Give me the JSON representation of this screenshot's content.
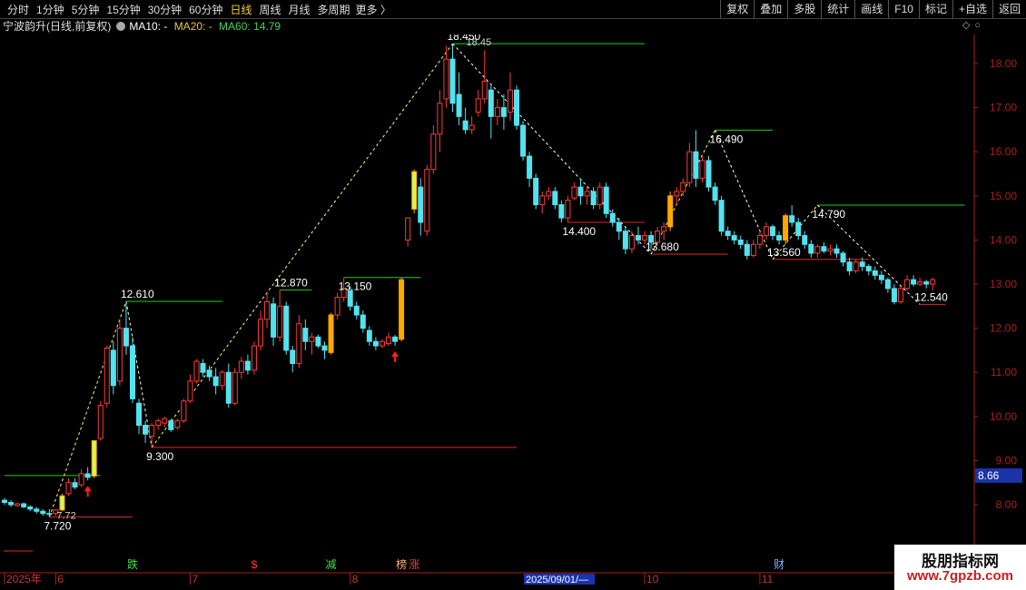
{
  "toolbar": {
    "periods": [
      "分时",
      "1分钟",
      "5分钟",
      "15分钟",
      "30分钟",
      "60分钟",
      "日线",
      "周线",
      "月线",
      "多周期"
    ],
    "active_period": "日线",
    "more": "更多",
    "right_tools": [
      "复权",
      "叠加",
      "多股",
      "统计",
      "画线",
      "F10",
      "标记",
      "+自选",
      "返回"
    ]
  },
  "info": {
    "stock_name": "宁波韵升(日线,前复权)",
    "ma10": "MA10: -",
    "ma20": "MA20: -",
    "ma60": "MA60: 14.79"
  },
  "colors": {
    "up": "#ff3a3a",
    "down": "#52e3f0",
    "signal": "#ffa800",
    "signal_light": "#d6f55a",
    "resistance_line": "#19d219",
    "support_line": "#e0282c",
    "zigzag": "#ffff66",
    "zigzag_down": "#ffffff",
    "axis": "#b01c1c",
    "current_price_bg": "#1b33a8"
  },
  "watermark": {
    "line1": "股朋指标网",
    "line2": "www.7gpzb.com"
  },
  "chart_data": {
    "type": "candlestick",
    "title": "宁波韵升",
    "y_ticks": [
      8.0,
      9.0,
      10.0,
      11.0,
      12.0,
      13.0,
      14.0,
      15.0,
      16.0,
      17.0,
      18.0
    ],
    "current_price": "8.66",
    "ylim": [
      7.2,
      18.8
    ],
    "x_labels": [
      "2025年",
      "6",
      "7",
      "8",
      "10",
      "11"
    ],
    "date_cursor": "2025/09/01/—",
    "candles": [
      {
        "o": 8.1,
        "h": 8.15,
        "l": 8.0,
        "c": 8.05
      },
      {
        "o": 8.05,
        "h": 8.1,
        "l": 7.95,
        "c": 8.0
      },
      {
        "o": 7.98,
        "h": 8.05,
        "l": 7.95,
        "c": 8.02
      },
      {
        "o": 8.02,
        "h": 8.05,
        "l": 7.92,
        "c": 7.95
      },
      {
        "o": 7.95,
        "h": 7.98,
        "l": 7.85,
        "c": 7.9
      },
      {
        "o": 7.9,
        "h": 7.95,
        "l": 7.8,
        "c": 7.85
      },
      {
        "o": 7.85,
        "h": 7.9,
        "l": 7.75,
        "c": 7.8
      },
      {
        "o": 7.8,
        "h": 7.9,
        "l": 7.72,
        "c": 7.78
      },
      {
        "o": 7.8,
        "h": 7.9,
        "l": 7.75,
        "c": 7.88
      },
      {
        "o": 7.88,
        "h": 8.25,
        "l": 7.85,
        "c": 8.2,
        "sig": "hl"
      },
      {
        "o": 8.25,
        "h": 8.6,
        "l": 8.2,
        "c": 8.5
      },
      {
        "o": 8.5,
        "h": 8.6,
        "l": 8.35,
        "c": 8.4
      },
      {
        "o": 8.45,
        "h": 8.8,
        "l": 8.4,
        "c": 8.7
      },
      {
        "o": 8.7,
        "h": 8.85,
        "l": 8.55,
        "c": 8.62
      },
      {
        "o": 8.65,
        "h": 9.45,
        "l": 8.6,
        "c": 9.45,
        "sig": "hl"
      },
      {
        "o": 9.5,
        "h": 10.35,
        "l": 9.45,
        "c": 10.25
      },
      {
        "o": 10.3,
        "h": 11.6,
        "l": 10.2,
        "c": 11.55
      },
      {
        "o": 11.5,
        "h": 11.7,
        "l": 10.5,
        "c": 10.7
      },
      {
        "o": 10.8,
        "h": 12.2,
        "l": 10.7,
        "c": 12.0
      },
      {
        "o": 12.0,
        "h": 12.61,
        "l": 11.4,
        "c": 11.6
      },
      {
        "o": 11.6,
        "h": 11.8,
        "l": 10.3,
        "c": 10.4
      },
      {
        "o": 10.3,
        "h": 10.4,
        "l": 9.6,
        "c": 9.8
      },
      {
        "o": 9.8,
        "h": 9.9,
        "l": 9.4,
        "c": 9.6
      },
      {
        "o": 9.55,
        "h": 9.85,
        "l": 9.3,
        "c": 9.8
      },
      {
        "o": 9.8,
        "h": 9.95,
        "l": 9.7,
        "c": 9.9
      },
      {
        "o": 9.85,
        "h": 10.0,
        "l": 9.75,
        "c": 9.95
      },
      {
        "o": 9.9,
        "h": 9.95,
        "l": 9.65,
        "c": 9.7
      },
      {
        "o": 9.75,
        "h": 9.95,
        "l": 9.7,
        "c": 9.9
      },
      {
        "o": 9.9,
        "h": 10.4,
        "l": 9.85,
        "c": 10.35
      },
      {
        "o": 10.35,
        "h": 10.95,
        "l": 10.3,
        "c": 10.8
      },
      {
        "o": 10.8,
        "h": 11.3,
        "l": 10.75,
        "c": 11.25
      },
      {
        "o": 11.2,
        "h": 11.3,
        "l": 10.9,
        "c": 11.0
      },
      {
        "o": 11.05,
        "h": 11.15,
        "l": 10.8,
        "c": 10.9
      },
      {
        "o": 10.9,
        "h": 11.1,
        "l": 10.5,
        "c": 10.7
      },
      {
        "o": 10.7,
        "h": 11.05,
        "l": 10.6,
        "c": 11.0
      },
      {
        "o": 11.0,
        "h": 11.2,
        "l": 10.2,
        "c": 10.3
      },
      {
        "o": 10.3,
        "h": 11.1,
        "l": 10.25,
        "c": 11.0
      },
      {
        "o": 11.0,
        "h": 11.35,
        "l": 10.85,
        "c": 11.25
      },
      {
        "o": 11.25,
        "h": 11.4,
        "l": 10.95,
        "c": 11.05
      },
      {
        "o": 11.05,
        "h": 11.7,
        "l": 10.95,
        "c": 11.6
      },
      {
        "o": 11.6,
        "h": 12.4,
        "l": 11.5,
        "c": 12.2
      },
      {
        "o": 12.2,
        "h": 12.8,
        "l": 12.0,
        "c": 12.6
      },
      {
        "o": 12.55,
        "h": 12.7,
        "l": 11.6,
        "c": 11.8
      },
      {
        "o": 11.8,
        "h": 12.87,
        "l": 11.7,
        "c": 12.5
      },
      {
        "o": 12.5,
        "h": 12.6,
        "l": 11.4,
        "c": 11.5
      },
      {
        "o": 11.5,
        "h": 11.6,
        "l": 11.0,
        "c": 11.2
      },
      {
        "o": 11.2,
        "h": 12.3,
        "l": 11.1,
        "c": 12.1
      },
      {
        "o": 12.0,
        "h": 12.2,
        "l": 11.5,
        "c": 11.7
      },
      {
        "o": 11.7,
        "h": 11.9,
        "l": 11.4,
        "c": 11.8
      },
      {
        "o": 11.8,
        "h": 11.85,
        "l": 11.55,
        "c": 11.6
      },
      {
        "o": 11.6,
        "h": 11.7,
        "l": 11.3,
        "c": 11.5
      },
      {
        "o": 11.45,
        "h": 12.35,
        "l": 11.4,
        "c": 12.3,
        "sig": "sig"
      },
      {
        "o": 12.3,
        "h": 12.8,
        "l": 12.2,
        "c": 12.7
      },
      {
        "o": 12.7,
        "h": 13.15,
        "l": 12.6,
        "c": 12.9
      },
      {
        "o": 12.85,
        "h": 12.95,
        "l": 12.4,
        "c": 12.5
      },
      {
        "o": 12.5,
        "h": 12.6,
        "l": 12.2,
        "c": 12.3
      },
      {
        "o": 12.3,
        "h": 12.4,
        "l": 11.9,
        "c": 12.0
      },
      {
        "o": 11.95,
        "h": 12.05,
        "l": 11.6,
        "c": 11.7
      },
      {
        "o": 11.7,
        "h": 11.8,
        "l": 11.5,
        "c": 11.6
      },
      {
        "o": 11.6,
        "h": 11.75,
        "l": 11.55,
        "c": 11.7
      },
      {
        "o": 11.65,
        "h": 11.9,
        "l": 11.6,
        "c": 11.8
      },
      {
        "o": 11.8,
        "h": 11.85,
        "l": 11.6,
        "c": 11.7
      },
      {
        "o": 11.75,
        "h": 13.15,
        "l": 11.7,
        "c": 13.1,
        "sig": "sig"
      },
      {
        "o": 14.0,
        "h": 14.5,
        "l": 13.85,
        "c": 14.5
      },
      {
        "o": 14.7,
        "h": 15.6,
        "l": 14.6,
        "c": 15.55,
        "sig": "hl"
      },
      {
        "o": 15.2,
        "h": 15.4,
        "l": 14.1,
        "c": 14.4
      },
      {
        "o": 14.2,
        "h": 15.7,
        "l": 14.1,
        "c": 15.6
      },
      {
        "o": 15.6,
        "h": 16.6,
        "l": 15.5,
        "c": 16.4
      },
      {
        "o": 16.4,
        "h": 17.4,
        "l": 16.0,
        "c": 17.1
      },
      {
        "o": 17.2,
        "h": 18.4,
        "l": 17.0,
        "c": 18.1
      },
      {
        "o": 18.1,
        "h": 18.45,
        "l": 16.9,
        "c": 17.1
      },
      {
        "o": 17.3,
        "h": 17.8,
        "l": 16.6,
        "c": 16.8
      },
      {
        "o": 16.7,
        "h": 17.0,
        "l": 16.4,
        "c": 16.5
      },
      {
        "o": 16.5,
        "h": 16.8,
        "l": 16.4,
        "c": 16.6
      },
      {
        "o": 16.9,
        "h": 17.4,
        "l": 16.8,
        "c": 17.2
      },
      {
        "o": 17.2,
        "h": 18.3,
        "l": 17.1,
        "c": 17.6
      },
      {
        "o": 17.4,
        "h": 17.5,
        "l": 16.3,
        "c": 16.8
      },
      {
        "o": 16.8,
        "h": 17.2,
        "l": 16.6,
        "c": 17.0
      },
      {
        "o": 17.0,
        "h": 17.3,
        "l": 16.5,
        "c": 16.8
      },
      {
        "o": 16.9,
        "h": 17.8,
        "l": 16.7,
        "c": 17.4
      },
      {
        "o": 17.4,
        "h": 17.5,
        "l": 16.5,
        "c": 16.6
      },
      {
        "o": 16.6,
        "h": 16.7,
        "l": 15.8,
        "c": 15.9
      },
      {
        "o": 15.9,
        "h": 16.0,
        "l": 15.2,
        "c": 15.4
      },
      {
        "o": 15.4,
        "h": 15.5,
        "l": 14.7,
        "c": 14.8
      },
      {
        "o": 14.8,
        "h": 15.1,
        "l": 14.6,
        "c": 15.0
      },
      {
        "o": 15.0,
        "h": 15.2,
        "l": 14.9,
        "c": 15.1
      },
      {
        "o": 15.1,
        "h": 15.2,
        "l": 14.7,
        "c": 14.8
      },
      {
        "o": 14.8,
        "h": 14.9,
        "l": 14.4,
        "c": 14.5
      },
      {
        "o": 14.5,
        "h": 15.0,
        "l": 14.4,
        "c": 14.9
      },
      {
        "o": 14.95,
        "h": 15.3,
        "l": 14.9,
        "c": 15.2
      },
      {
        "o": 15.2,
        "h": 15.4,
        "l": 14.8,
        "c": 15.0
      },
      {
        "o": 15.0,
        "h": 15.2,
        "l": 14.8,
        "c": 15.1
      },
      {
        "o": 15.1,
        "h": 15.2,
        "l": 14.7,
        "c": 14.8
      },
      {
        "o": 14.8,
        "h": 15.3,
        "l": 14.7,
        "c": 15.2
      },
      {
        "o": 15.2,
        "h": 15.3,
        "l": 14.5,
        "c": 14.6
      },
      {
        "o": 14.6,
        "h": 14.7,
        "l": 14.3,
        "c": 14.4
      },
      {
        "o": 14.4,
        "h": 14.5,
        "l": 14.0,
        "c": 14.2
      },
      {
        "o": 14.2,
        "h": 14.3,
        "l": 13.68,
        "c": 13.8
      },
      {
        "o": 13.8,
        "h": 14.2,
        "l": 13.7,
        "c": 14.1
      },
      {
        "o": 14.1,
        "h": 14.3,
        "l": 13.9,
        "c": 14.0
      },
      {
        "o": 14.0,
        "h": 14.2,
        "l": 13.9,
        "c": 14.1
      },
      {
        "o": 14.1,
        "h": 14.2,
        "l": 13.8,
        "c": 13.95
      },
      {
        "o": 13.95,
        "h": 14.3,
        "l": 13.9,
        "c": 14.2
      },
      {
        "o": 14.2,
        "h": 14.4,
        "l": 14.0,
        "c": 14.3
      },
      {
        "o": 14.3,
        "h": 15.1,
        "l": 14.2,
        "c": 15.0,
        "sig": "sig"
      },
      {
        "o": 15.0,
        "h": 15.2,
        "l": 14.8,
        "c": 15.1
      },
      {
        "o": 15.1,
        "h": 15.4,
        "l": 15.0,
        "c": 15.3
      },
      {
        "o": 15.3,
        "h": 16.2,
        "l": 15.2,
        "c": 16.0
      },
      {
        "o": 16.0,
        "h": 16.49,
        "l": 15.2,
        "c": 15.4
      },
      {
        "o": 15.4,
        "h": 15.9,
        "l": 15.3,
        "c": 15.8
      },
      {
        "o": 15.8,
        "h": 15.9,
        "l": 15.1,
        "c": 15.2
      },
      {
        "o": 15.2,
        "h": 15.3,
        "l": 14.8,
        "c": 14.9
      },
      {
        "o": 14.9,
        "h": 15.0,
        "l": 14.1,
        "c": 14.2
      },
      {
        "o": 14.2,
        "h": 14.3,
        "l": 14.0,
        "c": 14.1
      },
      {
        "o": 14.1,
        "h": 14.2,
        "l": 13.9,
        "c": 14.0
      },
      {
        "o": 14.0,
        "h": 14.1,
        "l": 13.8,
        "c": 13.9
      },
      {
        "o": 13.9,
        "h": 14.0,
        "l": 13.56,
        "c": 13.65
      },
      {
        "o": 13.65,
        "h": 14.0,
        "l": 13.6,
        "c": 13.9
      },
      {
        "o": 13.9,
        "h": 14.2,
        "l": 13.8,
        "c": 14.1
      },
      {
        "o": 14.1,
        "h": 14.4,
        "l": 14.0,
        "c": 14.3
      },
      {
        "o": 14.3,
        "h": 14.35,
        "l": 14.0,
        "c": 14.1
      },
      {
        "o": 14.1,
        "h": 14.2,
        "l": 13.9,
        "c": 14.0
      },
      {
        "o": 14.0,
        "h": 14.6,
        "l": 13.9,
        "c": 14.55,
        "sig": "sig"
      },
      {
        "o": 14.55,
        "h": 14.79,
        "l": 14.3,
        "c": 14.4
      },
      {
        "o": 14.4,
        "h": 14.5,
        "l": 14.0,
        "c": 14.1
      },
      {
        "o": 14.1,
        "h": 14.2,
        "l": 13.8,
        "c": 13.9
      },
      {
        "o": 13.9,
        "h": 14.0,
        "l": 13.6,
        "c": 13.7
      },
      {
        "o": 13.7,
        "h": 13.9,
        "l": 13.6,
        "c": 13.85
      },
      {
        "o": 13.85,
        "h": 13.95,
        "l": 13.7,
        "c": 13.75
      },
      {
        "o": 13.75,
        "h": 13.9,
        "l": 13.65,
        "c": 13.8
      },
      {
        "o": 13.8,
        "h": 13.9,
        "l": 13.6,
        "c": 13.7
      },
      {
        "o": 13.7,
        "h": 13.75,
        "l": 13.4,
        "c": 13.5
      },
      {
        "o": 13.5,
        "h": 13.6,
        "l": 13.2,
        "c": 13.3
      },
      {
        "o": 13.3,
        "h": 13.55,
        "l": 13.25,
        "c": 13.5
      },
      {
        "o": 13.5,
        "h": 13.6,
        "l": 13.3,
        "c": 13.4
      },
      {
        "o": 13.4,
        "h": 13.45,
        "l": 13.2,
        "c": 13.3
      },
      {
        "o": 13.3,
        "h": 13.4,
        "l": 13.1,
        "c": 13.2
      },
      {
        "o": 13.2,
        "h": 13.3,
        "l": 13.0,
        "c": 13.1
      },
      {
        "o": 13.1,
        "h": 13.15,
        "l": 12.8,
        "c": 12.9
      },
      {
        "o": 12.9,
        "h": 13.0,
        "l": 12.54,
        "c": 12.6
      },
      {
        "o": 12.6,
        "h": 12.95,
        "l": 12.55,
        "c": 12.9
      },
      {
        "o": 12.9,
        "h": 13.2,
        "l": 12.85,
        "c": 13.1
      },
      {
        "o": 13.1,
        "h": 13.2,
        "l": 12.95,
        "c": 13.0
      },
      {
        "o": 13.0,
        "h": 13.15,
        "l": 12.95,
        "c": 13.05
      },
      {
        "o": 13.05,
        "h": 13.1,
        "l": 12.9,
        "c": 13.0
      },
      {
        "o": 13.0,
        "h": 13.15,
        "l": 12.85,
        "c": 13.1
      }
    ],
    "pivots": [
      {
        "i": 7,
        "p": 7.72,
        "label": "7.720"
      },
      {
        "i": 19,
        "p": 12.61,
        "label": "12.610"
      },
      {
        "i": 23,
        "p": 9.3,
        "label": "9.300"
      },
      {
        "i": 43,
        "p": 12.87,
        "label": "12.870"
      },
      {
        "i": 53,
        "p": 13.15,
        "label": "13.150"
      },
      {
        "i": 70,
        "p": 18.45,
        "label": "18.450"
      },
      {
        "i": 88,
        "p": 14.4,
        "label": "14.400"
      },
      {
        "i": 101,
        "p": 13.68,
        "label": "13.680"
      },
      {
        "i": 111,
        "p": 16.49,
        "label": "16.490"
      },
      {
        "i": 120,
        "p": 13.56,
        "label": "13.560"
      },
      {
        "i": 127,
        "p": 14.79,
        "label": "14.790"
      },
      {
        "i": 143,
        "p": 12.54,
        "label": "12.540"
      }
    ],
    "zigzag_path": [
      7,
      19,
      23,
      70,
      101,
      111,
      120,
      127,
      143
    ],
    "annotations": [
      {
        "i": 7,
        "p": 7.72,
        "text": "7.72"
      },
      {
        "i": 71,
        "p": 18.45,
        "text": "18.45"
      }
    ],
    "levels": [
      {
        "from": 0,
        "to": 15,
        "p": 8.66,
        "kind": "resistance"
      },
      {
        "from": 19,
        "to": 34,
        "p": 12.61,
        "kind": "resistance"
      },
      {
        "from": 43,
        "to": 48,
        "p": 12.87,
        "kind": "resistance"
      },
      {
        "from": 53,
        "to": 65,
        "p": 13.15,
        "kind": "resistance"
      },
      {
        "from": 70,
        "to": 100,
        "p": 18.45,
        "kind": "resistance"
      },
      {
        "from": 111,
        "to": 120,
        "p": 16.49,
        "kind": "resistance"
      },
      {
        "from": 127,
        "to": 150,
        "p": 14.79,
        "kind": "resistance"
      },
      {
        "from": 7,
        "to": 20,
        "p": 7.72,
        "kind": "support"
      },
      {
        "from": 23,
        "to": 80,
        "p": 9.3,
        "kind": "support"
      },
      {
        "from": 88,
        "to": 100,
        "p": 14.4,
        "kind": "support"
      },
      {
        "from": 101,
        "to": 113,
        "p": 13.68,
        "kind": "support"
      },
      {
        "from": 120,
        "to": 135,
        "p": 13.56,
        "kind": "support"
      },
      {
        "from": 143,
        "to": 147,
        "p": 12.54,
        "kind": "support"
      }
    ],
    "buy_arrows": [
      13,
      61
    ],
    "event_marks": [
      {
        "i": 20,
        "text": "跌",
        "color": "#41e04a"
      },
      {
        "i": 39,
        "text": "$",
        "color": "#ff3a3a"
      },
      {
        "i": 51,
        "text": "减",
        "color": "#41e04a"
      },
      {
        "i": 62,
        "text": "榜",
        "color": "#ffb070"
      },
      {
        "i": 64,
        "text": "涨",
        "color": "#ff3a3a"
      },
      {
        "i": 121,
        "text": "财",
        "color": "#7fb0ff"
      }
    ],
    "x_label_positions": [
      0,
      8,
      29,
      54,
      100,
      118
    ]
  }
}
